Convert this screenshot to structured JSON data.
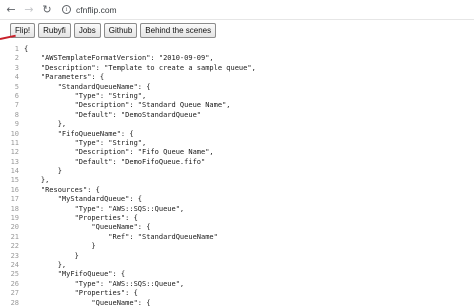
{
  "browser": {
    "url": "cfnflip.com",
    "back_icon": "arrow-left-icon",
    "forward_icon": "arrow-right-icon",
    "reload_icon": "reload-icon",
    "info_icon": "info-icon"
  },
  "toolbar": {
    "buttons": [
      "Flip!",
      "Rubyfi",
      "Jobs",
      "Github",
      "Behind the scenes"
    ]
  },
  "colors": {
    "annotation_mark": "#c8202a"
  },
  "editor": {
    "lines": [
      {
        "n": "1",
        "text": "{"
      },
      {
        "n": "2",
        "text": "    \"AWSTemplateFormatVersion\": \"2010-09-09\","
      },
      {
        "n": "3",
        "text": "    \"Description\": \"Template to create a sample queue\","
      },
      {
        "n": "4",
        "text": "    \"Parameters\": {"
      },
      {
        "n": "5",
        "text": "        \"StandardQueueName\": {"
      },
      {
        "n": "6",
        "text": "            \"Type\": \"String\","
      },
      {
        "n": "7",
        "text": "            \"Description\": \"Standard Queue Name\","
      },
      {
        "n": "8",
        "text": "            \"Default\": \"DemoStandardQueue\""
      },
      {
        "n": "9",
        "text": "        },"
      },
      {
        "n": "10",
        "text": "        \"FifoQueueName\": {"
      },
      {
        "n": "11",
        "text": "            \"Type\": \"String\","
      },
      {
        "n": "12",
        "text": "            \"Description\": \"Fifo Queue Name\","
      },
      {
        "n": "13",
        "text": "            \"Default\": \"DemoFifoQueue.fifo\""
      },
      {
        "n": "14",
        "text": "        }"
      },
      {
        "n": "15",
        "text": "    },"
      },
      {
        "n": "16",
        "text": "    \"Resources\": {"
      },
      {
        "n": "17",
        "text": "        \"MyStandardQueue\": {"
      },
      {
        "n": "18",
        "text": "            \"Type\": \"AWS::SQS::Queue\","
      },
      {
        "n": "19",
        "text": "            \"Properties\": {"
      },
      {
        "n": "20",
        "text": "                \"QueueName\": {"
      },
      {
        "n": "21",
        "text": "                    \"Ref\": \"StandardQueueName\""
      },
      {
        "n": "22",
        "text": "                }"
      },
      {
        "n": "23",
        "text": "            }"
      },
      {
        "n": "24",
        "text": "        },"
      },
      {
        "n": "25",
        "text": "        \"MyFifoQueue\": {"
      },
      {
        "n": "26",
        "text": "            \"Type\": \"AWS::SQS::Queue\","
      },
      {
        "n": "27",
        "text": "            \"Properties\": {"
      },
      {
        "n": "28",
        "text": "                \"QueueName\": {"
      }
    ]
  }
}
